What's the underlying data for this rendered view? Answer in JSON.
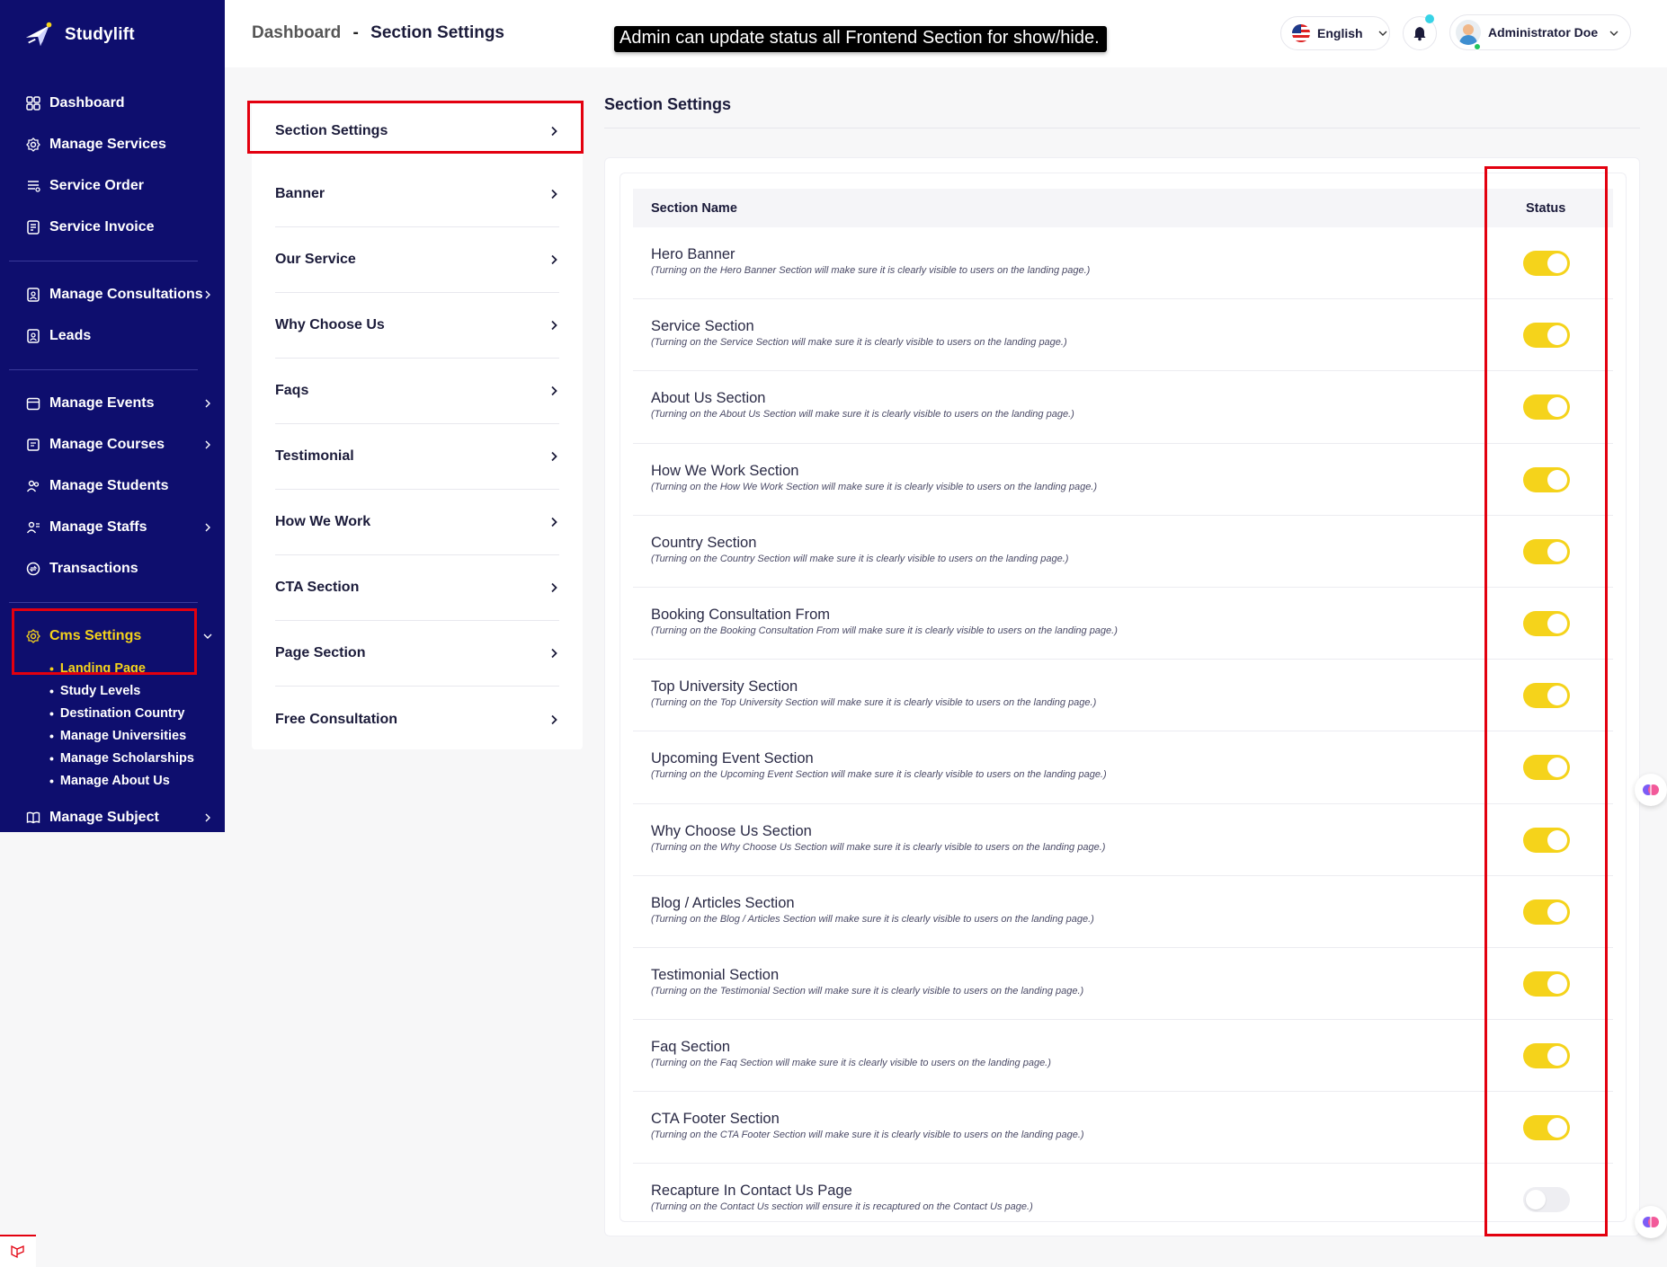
{
  "brand": {
    "name": "Studylift"
  },
  "sidebar": {
    "group1": [
      {
        "label": "Dashboard",
        "icon": "dashboard-icon"
      },
      {
        "label": "Manage Services",
        "icon": "gear-icon"
      },
      {
        "label": "Service Order",
        "icon": "list-icon"
      },
      {
        "label": "Service Invoice",
        "icon": "invoice-icon"
      }
    ],
    "group2": [
      {
        "label": "Manage Consultations",
        "icon": "consultation-icon"
      },
      {
        "label": "Leads",
        "icon": "leads-icon"
      }
    ],
    "group3": [
      {
        "label": "Manage Events",
        "icon": "calendar-icon"
      },
      {
        "label": "Manage Courses",
        "icon": "course-icon"
      },
      {
        "label": "Manage Students",
        "icon": "students-icon"
      },
      {
        "label": "Manage Staffs",
        "icon": "staffs-icon"
      },
      {
        "label": "Transactions",
        "icon": "transactions-icon"
      }
    ],
    "cms": {
      "label": "Cms Settings",
      "sub": [
        "Landing Page",
        "Study Levels",
        "Destination Country",
        "Manage Universities",
        "Manage Scholarships",
        "Manage About Us"
      ]
    },
    "subject": {
      "label": "Manage Subject"
    }
  },
  "topbar": {
    "crumb_root": "Dashboard",
    "crumb_sep": "-",
    "crumb_current": "Section Settings",
    "tooltip": "Admin can update status all Frontend Section for show/hide.",
    "language": "English",
    "user_name": "Administrator Doe"
  },
  "settings_menu": [
    "Section Settings",
    "Banner",
    "Our Service",
    "Why Choose Us",
    "Faqs",
    "Testimonial",
    "How We Work",
    "CTA Section",
    "Page Section",
    "Free Consultation"
  ],
  "panel": {
    "title": "Section Settings",
    "col_name": "Section Name",
    "col_status": "Status"
  },
  "sections": [
    {
      "name": "Hero Banner",
      "desc": "(Turning on the Hero Banner Section will make sure it is clearly visible to users on the landing page.)",
      "on": true
    },
    {
      "name": "Service Section",
      "desc": "(Turning on the Service Section will make sure it is clearly visible to users on the landing page.)",
      "on": true
    },
    {
      "name": "About Us Section",
      "desc": "(Turning on the About Us Section will make sure it is clearly visible to users on the landing page.)",
      "on": true
    },
    {
      "name": "How We Work Section",
      "desc": "(Turning on the How We Work Section will make sure it is clearly visible to users on the landing page.)",
      "on": true
    },
    {
      "name": "Country Section",
      "desc": "(Turning on the Country Section will make sure it is clearly visible to users on the landing page.)",
      "on": true
    },
    {
      "name": "Booking Consultation From",
      "desc": "(Turning on the Booking Consultation From will make sure it is clearly visible to users on the landing page.)",
      "on": true
    },
    {
      "name": "Top University Section",
      "desc": "(Turning on the Top University Section will make sure it is clearly visible to users on the landing page.)",
      "on": true
    },
    {
      "name": "Upcoming Event Section",
      "desc": "(Turning on the Upcoming Event Section will make sure it is clearly visible to users on the landing page.)",
      "on": true
    },
    {
      "name": "Why Choose Us Section",
      "desc": "(Turning on the Why Choose Us Section will make sure it is clearly visible to users on the landing page.)",
      "on": true
    },
    {
      "name": "Blog / Articles Section",
      "desc": "(Turning on the Blog / Articles Section will make sure it is clearly visible to users on the landing page.)",
      "on": true
    },
    {
      "name": "Testimonial Section",
      "desc": "(Turning on the Testimonial Section will make sure it is clearly visible to users on the landing page.)",
      "on": true
    },
    {
      "name": "Faq Section",
      "desc": "(Turning on the Faq Section will make sure it is clearly visible to users on the landing page.)",
      "on": true
    },
    {
      "name": "CTA Footer Section",
      "desc": "(Turning on the CTA Footer Section will make sure it is clearly visible to users on the landing page.)",
      "on": true
    },
    {
      "name": "Recapture In Contact Us Page",
      "desc": "(Turning on the Contact Us section will ensure it is recaptured on the Contact Us page.)",
      "on": false
    }
  ],
  "colors": {
    "sidebar": "#0e0e6e",
    "accent": "#f5d31b",
    "highlight": "#e3000f"
  }
}
